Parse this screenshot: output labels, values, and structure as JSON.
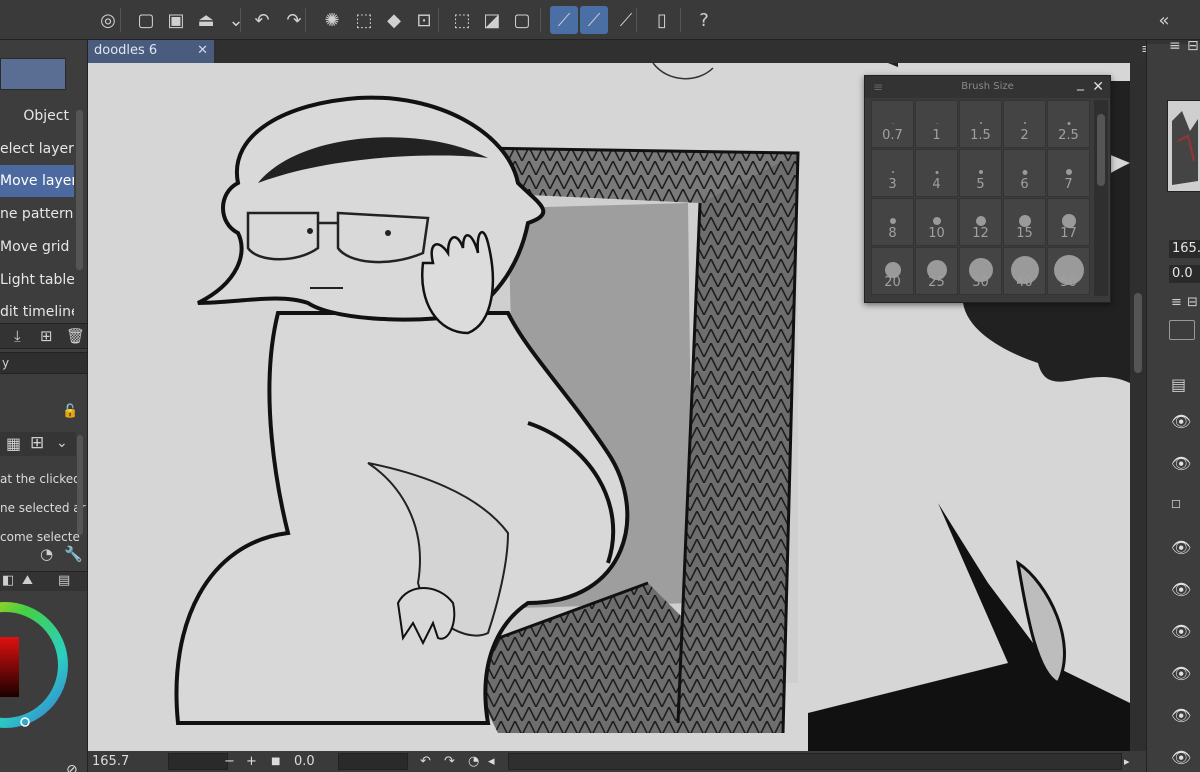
{
  "toolbar": {
    "buttons": [
      {
        "name": "app-logo-icon",
        "glyph": "◎"
      },
      {
        "name": "new-canvas-icon",
        "glyph": "▢"
      },
      {
        "name": "open-folder-icon",
        "glyph": "▣"
      },
      {
        "name": "save-icon",
        "glyph": "⏏"
      },
      {
        "name": "dropdown-icon",
        "glyph": "⌄"
      },
      {
        "name": "undo-icon",
        "glyph": "↶"
      },
      {
        "name": "redo-icon",
        "glyph": "↷"
      },
      {
        "name": "loading-icon",
        "glyph": "✺"
      },
      {
        "name": "clear-icon",
        "glyph": "⬚"
      },
      {
        "name": "fill-icon",
        "glyph": "◆"
      },
      {
        "name": "transform-icon",
        "glyph": "⊡"
      },
      {
        "name": "deselect-icon",
        "glyph": "⬚"
      },
      {
        "name": "invert-selection-icon",
        "glyph": "◪"
      },
      {
        "name": "selection-border-icon",
        "glyph": "▢"
      },
      {
        "name": "ruler-snap-icon",
        "glyph": "⟋"
      },
      {
        "name": "special-ruler-snap-icon",
        "glyph": "⟋"
      },
      {
        "name": "grid-snap-icon",
        "glyph": "⟋"
      },
      {
        "name": "smartphone-icon",
        "glyph": "▯"
      },
      {
        "name": "help-icon",
        "glyph": "?"
      }
    ],
    "collapse_glyph": "«"
  },
  "left_panel": {
    "subtools": [
      {
        "label": "Object",
        "selected": false
      },
      {
        "label": "elect layer",
        "selected": false
      },
      {
        "label": "Move layer",
        "selected": true
      },
      {
        "label": "ne pattern",
        "selected": false
      },
      {
        "label": "Move grid",
        "selected": false
      },
      {
        "label": "Light table",
        "selected": false
      },
      {
        "label": "dit timeline",
        "selected": false
      }
    ],
    "tab_label": "y",
    "settings_lines": [
      "at the clicked",
      "ne selected ar",
      "come selecte"
    ]
  },
  "document_tab": {
    "title": "doodles 6",
    "close_glyph": "✕"
  },
  "brush_palette": {
    "title": "Brush Size",
    "minimize_glyph": "_",
    "close_glyph": "✕",
    "sizes": [
      "0.7",
      "1",
      "1.5",
      "2",
      "2.5",
      "3",
      "4",
      "5",
      "6",
      "7",
      "8",
      "10",
      "12",
      "15",
      "17",
      "20",
      "25",
      "30",
      "40",
      "50"
    ],
    "dot_diameters": [
      1,
      1,
      2,
      2,
      3,
      2,
      3,
      4,
      5,
      6,
      6,
      8,
      10,
      12,
      14,
      16,
      20,
      24,
      28,
      30
    ]
  },
  "status_bar": {
    "zoom": "165.7",
    "minus": "−",
    "plus": "+",
    "angle": "0.0"
  },
  "right_panel": {
    "zoom_value": "165.",
    "angle_value": "0.0"
  }
}
